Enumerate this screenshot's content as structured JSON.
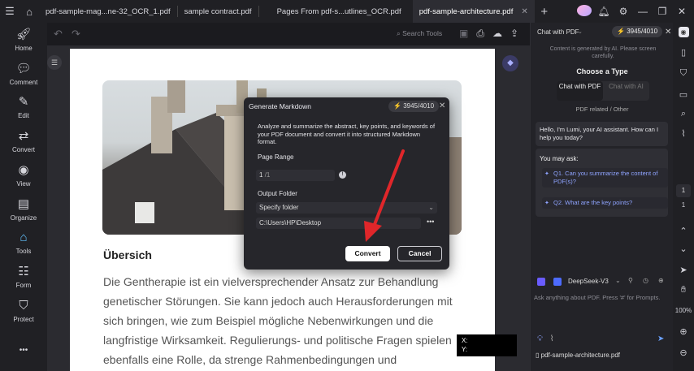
{
  "tabs": [
    {
      "label": "pdf-sample-mag...ne-32_OCR_1.pdf",
      "active": false
    },
    {
      "label": "sample contract.pdf",
      "active": false
    },
    {
      "label": "Pages From pdf-s...utlines_OCR.pdf",
      "active": false
    },
    {
      "label": "pdf-sample-architecture.pdf",
      "active": true
    }
  ],
  "sidebar": {
    "items": [
      {
        "label": "Home",
        "icon": "rocket-icon"
      },
      {
        "label": "Comment",
        "icon": "comment-icon"
      },
      {
        "label": "Edit",
        "icon": "edit-icon"
      },
      {
        "label": "Convert",
        "icon": "convert-icon"
      },
      {
        "label": "View",
        "icon": "eye-icon"
      },
      {
        "label": "Organize",
        "icon": "organize-icon"
      },
      {
        "label": "Tools",
        "icon": "tools-icon"
      },
      {
        "label": "Form",
        "icon": "form-icon"
      },
      {
        "label": "Protect",
        "icon": "shield-icon"
      }
    ],
    "more": "•••"
  },
  "toolbar": {
    "search_label": "Search Tools"
  },
  "document": {
    "heading": "Übersich",
    "paragraph": "Die Gentherapie ist ein vielversprechender Ansatz zur Behandlung genetischer Störungen. Sie kann jedoch auch Herausforderungen mit sich bringen, wie zum Beispiel mögliche Nebenwirkungen und die langfristige Wirksamkeit. Regulierungs- und politische Fragen spielen ebenfalls eine Rolle, da strenge Rahmenbedingungen und"
  },
  "coords": {
    "x_label": "X:",
    "y_label": "Y:"
  },
  "dialog": {
    "title": "Generate Markdown",
    "credits": "3945/4010",
    "description": "Analyze and summarize the abstract, key points, and keywords of your PDF document and convert it into structured Markdown format.",
    "page_range_label": "Page Range",
    "page_value": "1",
    "page_total": "/1",
    "output_folder_label": "Output Folder",
    "folder_option": "Specify folder",
    "folder_path": "C:\\Users\\HP\\Desktop",
    "convert_label": "Convert",
    "cancel_label": "Cancel"
  },
  "chat": {
    "mode": "Chat with PDF",
    "credits": "3945/4010",
    "notice": "Content is generated by AI. Please screen carefully.",
    "choose_type": "Choose a Type",
    "tab_pdf": "Chat with PDF",
    "tab_ai": "Chat with AI",
    "related": "PDF related / Other",
    "greeting": "Hello, I'm Lumi, your AI assistant. How can I help you today?",
    "you_may_ask": "You may ask:",
    "q1": "Q1. Can you summarize the content of PDF(s)?",
    "q2": "Q2. What are the key points?",
    "model": "DeepSeek-V3",
    "prompt_placeholder": "Ask anything about PDF. Press '#' for Prompts.",
    "file_name": "pdf-sample-architecture.pdf"
  },
  "right_strip": {
    "page_current": "1",
    "page_total": "1",
    "zoom": "100%"
  },
  "colors": {
    "accent": "#63c3ff",
    "link": "#8fa4ff",
    "arrow": "#e0262a"
  }
}
